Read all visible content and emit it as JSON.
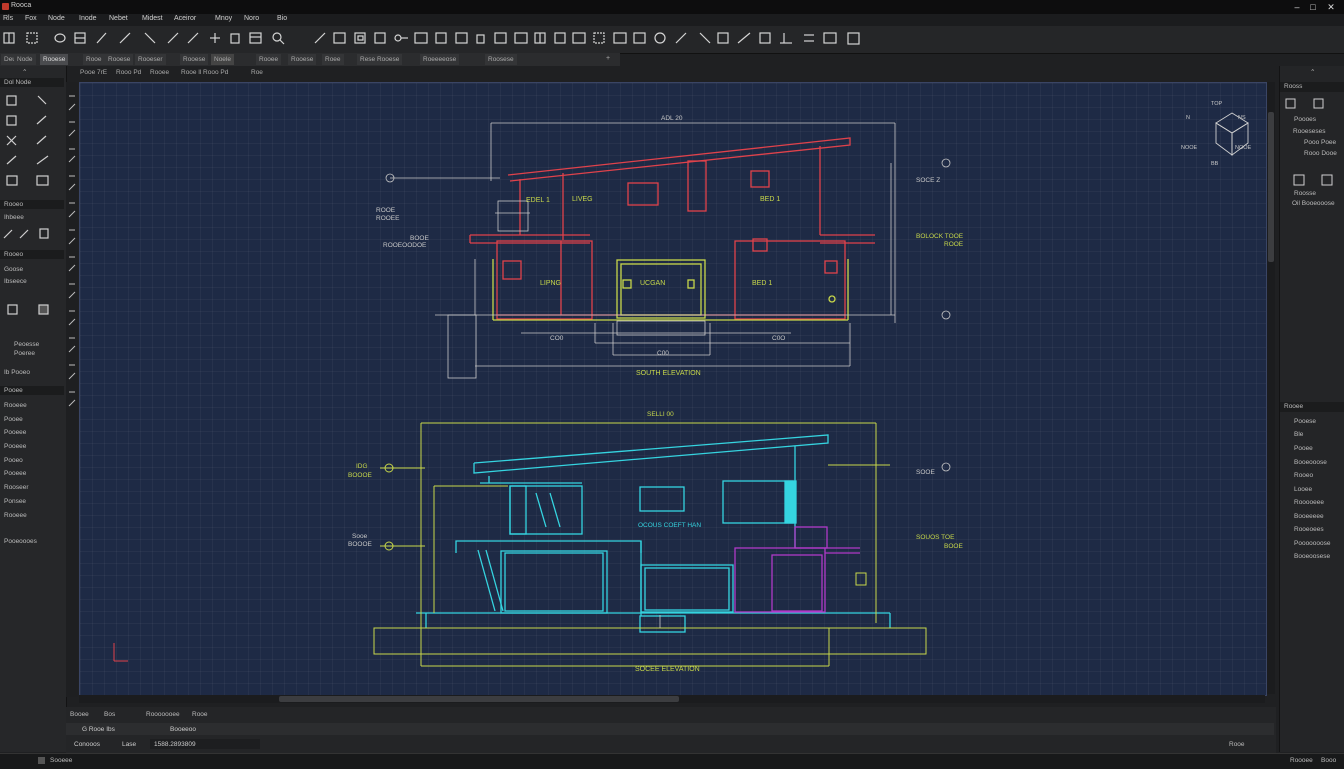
{
  "titlebar": {
    "title": "Rooca"
  },
  "menu": [
    "Rls",
    "Fox",
    "Node",
    "Inode",
    "Nebet",
    "Midest",
    "Aceiror",
    "Mnoy",
    "Noro",
    "Bio"
  ],
  "tabs": [
    "Deu",
    "Node",
    "Rooese",
    "Rooe",
    "Rooese",
    "Rooeser",
    "Rooese",
    "Noele",
    "Rooee",
    "Rooese",
    "Roee",
    "Rese Rooese",
    "Roeeeeose",
    "Roosese"
  ],
  "subtabs": [
    "Pooe 7rE",
    "Rooo Pd",
    "Rooee",
    "Rooe ll Rooo Pd",
    "Roe"
  ],
  "left_panel": {
    "top_label": "Dol Node",
    "section1": [
      "Rooeo",
      "Ihbeee"
    ],
    "section2_head": "Rooeo",
    "section2": [
      "Goose",
      "Ibseece"
    ],
    "section3": [
      "Peoesse",
      "Poeree"
    ],
    "section4_head": "Ib Pooeo",
    "section5_head": "Pooee",
    "list": [
      "Rooeee",
      "Pooee",
      "Pooeee",
      "Pooeee",
      "Pooeo",
      "Pooeee",
      "Rooseer",
      "Ponsee",
      "Rooeee",
      "Pooeoooes"
    ]
  },
  "drawing": {
    "top_note": "ADL 20",
    "upper_title": "SOUTH ELEVATION",
    "rooms_upper": [
      "EDEL 1",
      "LIVEG",
      "BED 1"
    ],
    "rooms_lower": [
      "LIPNG",
      "UCGAN",
      "BED 1"
    ],
    "left_notes": [
      "ROOE",
      "ROOEE",
      "BOOE",
      "ROOEOODOE"
    ],
    "right_notes": [
      "SOCE Z",
      "BOLOCK TOOE",
      "ROOE"
    ],
    "dims_upper": [
      "CO0",
      "C0O",
      "C00"
    ],
    "lower_scale": "SELLI 00",
    "lower_title": "SOCEE ELEVATION",
    "lower_mid": "OCOUS COEFT HAN",
    "lower_left_notes": [
      "IDG",
      "BOOOE",
      "Sooe",
      "BOOOE"
    ],
    "lower_right_notes": [
      "SOOE",
      "SOUOS TOE",
      "BOOE"
    ],
    "viewcube": {
      "top": "TOP",
      "left": "NOOE",
      "right": "NOOE",
      "bottom": "BB",
      "west": "N",
      "east": "NS"
    }
  },
  "right_panel": {
    "head1": "Rooss",
    "items1": [
      "Poooes",
      "Rooeseses",
      "Pooo Poee",
      "Rooo Dooe"
    ],
    "items2": [
      "Roosse",
      "Oil Booeooose"
    ],
    "head2": "Rooee",
    "list": [
      "Pooese",
      "Ble",
      "Pooee",
      "Booeooose",
      "Rooeo",
      "Looee",
      "Rooooeee",
      "Booeeeee",
      "Rooeoees",
      "Pooooooose",
      "Booeoosese"
    ]
  },
  "command": {
    "tabs": [
      "Booee",
      "Bos",
      "Rooooooee",
      "Rooe"
    ],
    "line2": [
      "G Rooe Ibs",
      "Booeeoo"
    ],
    "coords_label": "Conooos",
    "coords_label2": "Lase",
    "coords_value": "1588.2893809",
    "right_text": "Rooe"
  },
  "status": {
    "left": "Sooeee",
    "right": [
      "Roooee",
      "Booo"
    ]
  },
  "colors": {
    "canvas": "#1e2a45",
    "red": "#e0424b",
    "yellow": "#c8d84a",
    "cyan": "#35d4e0",
    "magenta": "#b039c8",
    "dim": "#c8c8c8"
  }
}
